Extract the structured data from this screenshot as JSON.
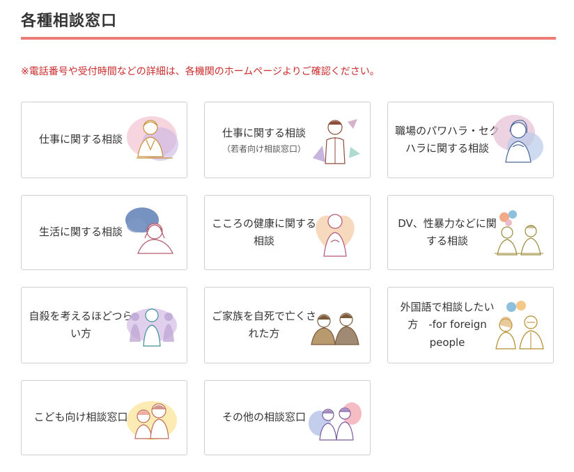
{
  "header": {
    "title": "各種相談窓口"
  },
  "notice": "※電話番号や受付時間などの詳細は、各機関のホームページよりご確認ください。",
  "cards": [
    {
      "label": "仕事に関する相談",
      "sub": "",
      "icon": "worried-businessman-illustration"
    },
    {
      "label": "仕事に関する相談",
      "sub": "（若者向け相談窓口）",
      "icon": "young-man-illustration"
    },
    {
      "label": "職場のパワハラ・セクハラに関する相談",
      "sub": "",
      "icon": "troubled-woman-illustration"
    },
    {
      "label": "生活に関する相談",
      "sub": "",
      "icon": "head-in-hands-illustration"
    },
    {
      "label": "こころの健康に関する相談",
      "sub": "",
      "icon": "heart-person-illustration"
    },
    {
      "label": "DV、性暴力などに関する相談",
      "sub": "",
      "icon": "counseling-pair-illustration"
    },
    {
      "label": "自殺を考えるほどつらい方",
      "sub": "",
      "icon": "lonely-person-illustration"
    },
    {
      "label": "ご家族を自死で亡くされた方",
      "sub": "",
      "icon": "grieving-couple-illustration"
    },
    {
      "label": "外国語で相談したい方　-for foreign people",
      "sub": "",
      "icon": "foreign-conversation-illustration"
    },
    {
      "label": "こども向け相談窓口",
      "sub": "",
      "icon": "children-illustration"
    },
    {
      "label": "その他の相談窓口",
      "sub": "",
      "icon": "two-people-talking-illustration"
    }
  ],
  "colors": {
    "accent_rule": "#ee7b78",
    "notice_text": "#cc2c2c",
    "card_border": "#cfcfcf"
  }
}
